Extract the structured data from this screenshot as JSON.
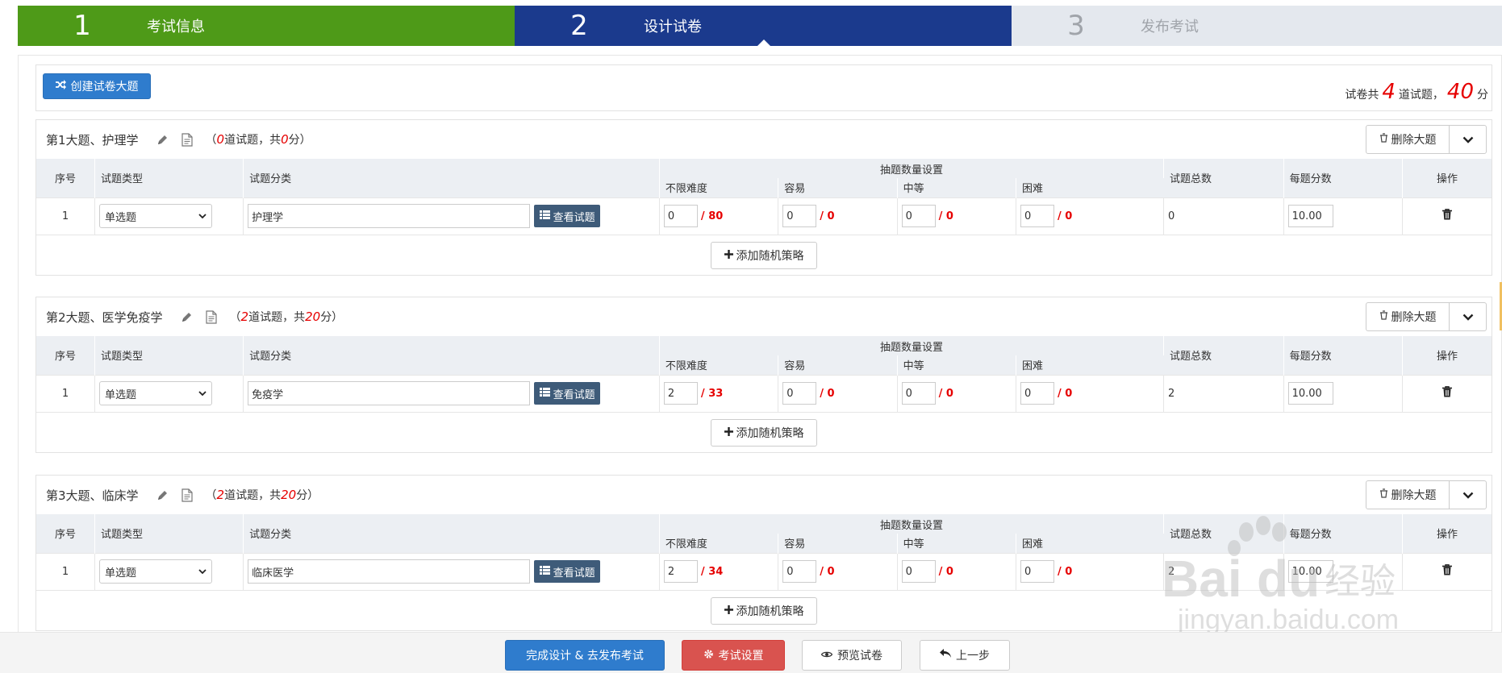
{
  "steps": [
    {
      "num": "1",
      "label": "考试信息"
    },
    {
      "num": "2",
      "label": "设计试卷"
    },
    {
      "num": "3",
      "label": "发布考试"
    }
  ],
  "toolbar": {
    "create_label": "创建试卷大题",
    "summary_prefix": "试卷共",
    "total_questions": "4",
    "summary_mid": "道试题，",
    "total_score": "40",
    "summary_suffix": "分"
  },
  "headers": {
    "seq": "序号",
    "type": "试题类型",
    "category": "试题分类",
    "draw_settings": "抽题数量设置",
    "any": "不限难度",
    "easy": "容易",
    "medium": "中等",
    "hard": "困难",
    "total": "试题总数",
    "score": "每题分数",
    "op": "操作"
  },
  "common": {
    "delete_label": "删除大题",
    "view_label": "查看试题",
    "add_label": "添加随机策略",
    "info_prefix": "（",
    "info_mid": "道试题，共",
    "info_suffix": "分）"
  },
  "sections": [
    {
      "title": "第1大题、护理学",
      "count": "0",
      "score": "0",
      "row": {
        "seq": "1",
        "type": "单选题",
        "category": "护理学",
        "any": "0",
        "any_max": "/ 80",
        "easy": "0",
        "easy_max": "/ 0",
        "medium": "0",
        "medium_max": "/ 0",
        "hard": "0",
        "hard_max": "/ 0",
        "total": "0",
        "per_score": "10.00"
      }
    },
    {
      "title": "第2大题、医学免疫学",
      "count": "2",
      "score": "20",
      "row": {
        "seq": "1",
        "type": "单选题",
        "category": "免疫学",
        "any": "2",
        "any_max": "/ 33",
        "easy": "0",
        "easy_max": "/ 0",
        "medium": "0",
        "medium_max": "/ 0",
        "hard": "0",
        "hard_max": "/ 0",
        "total": "2",
        "per_score": "10.00"
      }
    },
    {
      "title": "第3大题、临床学",
      "count": "2",
      "score": "20",
      "row": {
        "seq": "1",
        "type": "单选题",
        "category": "临床医学",
        "any": "2",
        "any_max": "/ 34",
        "easy": "0",
        "easy_max": "/ 0",
        "medium": "0",
        "medium_max": "/ 0",
        "hard": "0",
        "hard_max": "/ 0",
        "total": "2",
        "per_score": "10.00"
      }
    }
  ],
  "footer": {
    "done_label": "完成设计 & 去发布考试",
    "settings_label": "考试设置",
    "preview_label": "预览试卷",
    "back_label": "上一步"
  },
  "watermark": {
    "brand": "Bai",
    "brand2": "du",
    "cn": "经验",
    "url": "jingyan.baidu.com"
  }
}
